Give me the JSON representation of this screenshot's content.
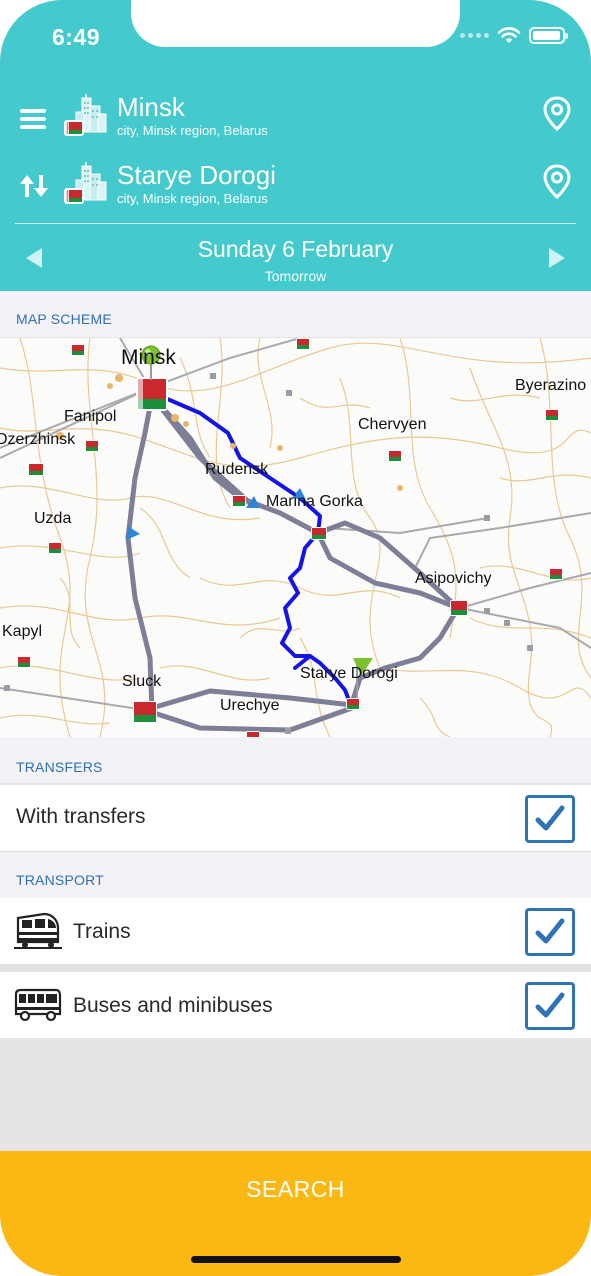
{
  "status_bar": {
    "time": "6:49"
  },
  "route": {
    "from": {
      "name": "Minsk",
      "details": "city, Minsk region, Belarus"
    },
    "to": {
      "name": "Starye Dorogi",
      "details": "city, Minsk region, Belarus"
    }
  },
  "date": {
    "main": "Sunday 6 February",
    "relative": "Tomorrow"
  },
  "map_section": {
    "title": "MAP SCHEME",
    "places": [
      "Minsk",
      "Fanipol",
      "Dzerzhinsk",
      "Uzda",
      "Rudensk",
      "Marina Gorka",
      "Chervyen",
      "Byerazino",
      "Asipovichy",
      "Kapyl",
      "Sluck",
      "Urechye",
      "Starye Dorogi"
    ]
  },
  "transfers": {
    "title": "TRANSFERS",
    "with_transfers_label": "With transfers",
    "with_transfers_checked": true
  },
  "transport": {
    "title": "TRANSPORT",
    "items": [
      {
        "label": "Trains",
        "icon": "train-icon",
        "checked": true
      },
      {
        "label": "Buses and minibuses",
        "icon": "bus-icon",
        "checked": true
      }
    ]
  },
  "search_button": {
    "label": "SEARCH"
  },
  "colors": {
    "header": "#44c9cc",
    "accent_blue": "#2f73b6",
    "search": "#fbb813",
    "route_blue": "#1414e6",
    "route_gray": "#7d7f96"
  }
}
